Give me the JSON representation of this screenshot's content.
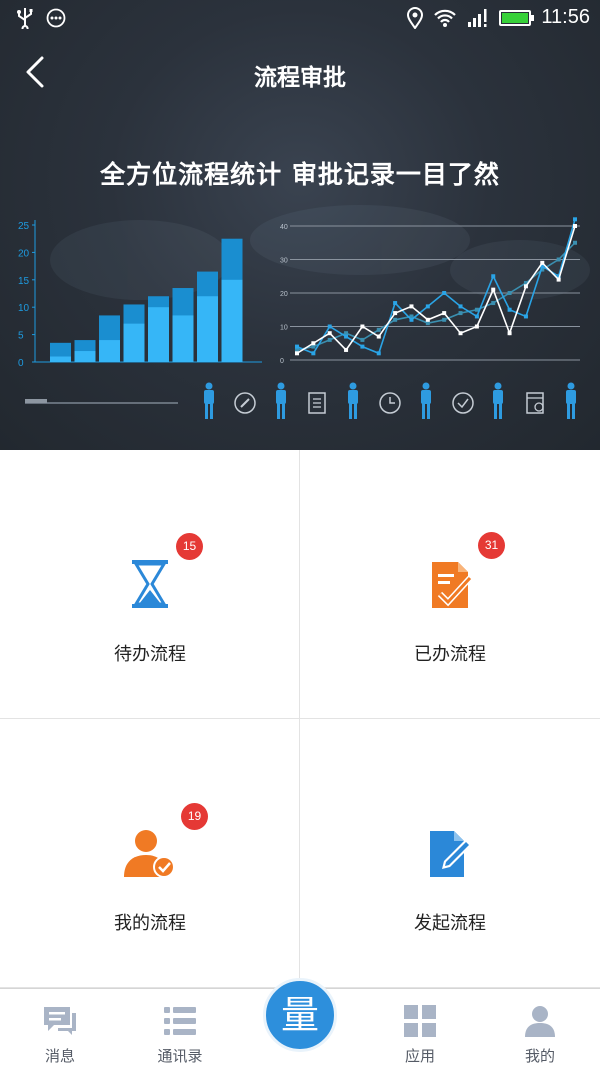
{
  "status_bar": {
    "time": "11:56"
  },
  "nav": {
    "title": "流程审批"
  },
  "banner": {
    "title": "全方位流程统计 审批记录一目了然",
    "bar_chart": {
      "y_ticks": [
        "25",
        "20",
        "15",
        "10",
        "5",
        "0"
      ],
      "dark_values": [
        3.5,
        4,
        8.5,
        10.5,
        12,
        13.5,
        16.5,
        22.5
      ],
      "light_values": [
        1,
        2,
        4,
        7,
        10,
        8.5,
        12,
        15
      ]
    },
    "line_chart": {
      "y_ticks": [
        "40",
        "30",
        "20",
        "10",
        "0"
      ],
      "series_white": [
        2,
        5,
        8,
        3,
        10,
        7,
        14,
        16,
        12,
        14,
        8,
        10,
        21,
        8,
        22,
        29,
        24,
        40
      ],
      "series_blue": [
        4,
        2,
        10,
        7,
        4,
        2,
        17,
        12,
        16,
        20,
        16,
        13,
        25,
        15,
        13,
        28,
        25,
        42
      ],
      "series_teal": [
        3,
        4,
        6,
        8,
        6,
        9,
        12,
        13,
        11,
        12,
        14,
        15,
        17,
        20,
        23,
        27,
        30,
        35
      ]
    }
  },
  "grid": {
    "pending": {
      "label": "待办流程",
      "badge": "15",
      "icon_color": "#2b88d8"
    },
    "done": {
      "label": "已办流程",
      "badge": "31",
      "icon_color": "#f07a24"
    },
    "mine": {
      "label": "我的流程",
      "badge": "19",
      "icon_color": "#f07a24"
    },
    "start": {
      "label": "发起流程",
      "icon_color": "#2b88d8"
    }
  },
  "tabbar": {
    "tabs": [
      {
        "label": "消息",
        "icon": "chat-icon"
      },
      {
        "label": "通讯录",
        "icon": "list-icon"
      },
      {
        "label": "应用",
        "icon": "apps-icon"
      },
      {
        "label": "我的",
        "icon": "person-icon"
      }
    ],
    "center": {
      "label": "量"
    }
  }
}
